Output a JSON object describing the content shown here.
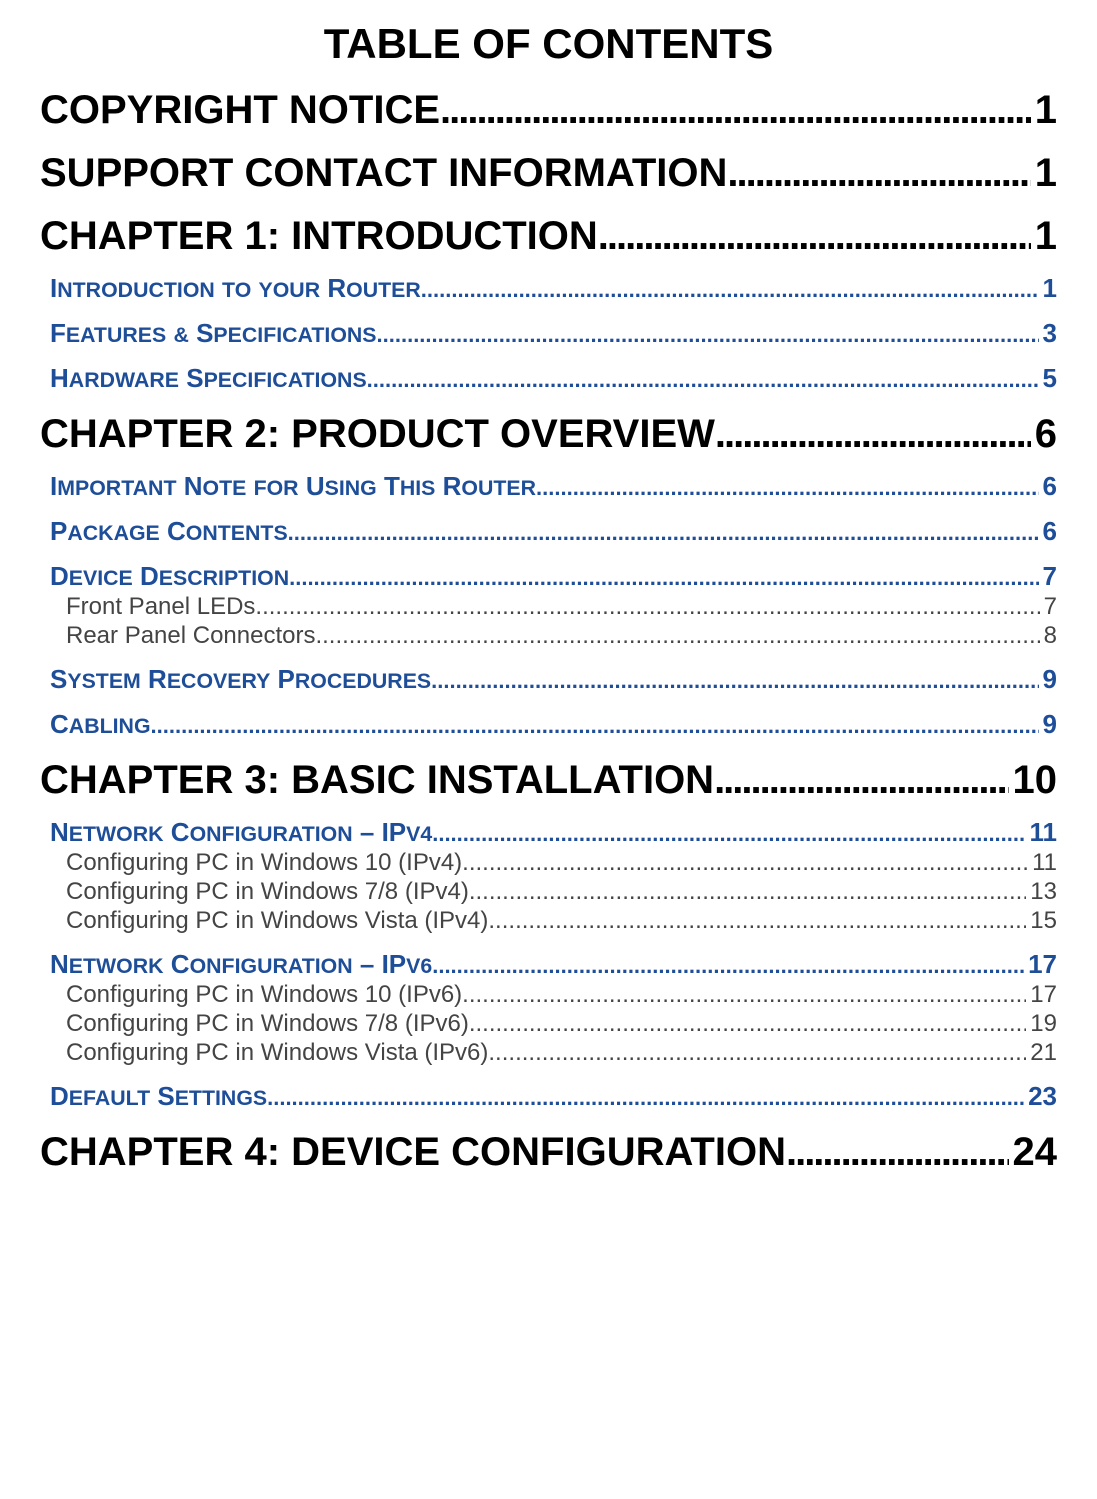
{
  "title": "TABLE OF CONTENTS",
  "entries": [
    {
      "level": 1,
      "text": "COPYRIGHT NOTICE",
      "page": "1"
    },
    {
      "level": 1,
      "text": "SUPPORT CONTACT INFORMATION",
      "page": "1"
    },
    {
      "level": 1,
      "text": "CHAPTER 1: INTRODUCTION",
      "page": "1"
    },
    {
      "level": 2,
      "text": "Introduction to your Router",
      "page": "1"
    },
    {
      "level": 2,
      "text": "Features & Specifications",
      "page": "3"
    },
    {
      "level": 2,
      "text": "Hardware Specifications",
      "page": "5"
    },
    {
      "level": 1,
      "text": "CHAPTER 2: PRODUCT OVERVIEW",
      "page": "6"
    },
    {
      "level": 2,
      "text": "Important Note for Using This Router",
      "page": "6"
    },
    {
      "level": 2,
      "text": "Package Contents",
      "page": "6"
    },
    {
      "level": 2,
      "text": "Device Description",
      "page": "7"
    },
    {
      "level": 3,
      "text": "Front Panel LEDs",
      "page": "7"
    },
    {
      "level": 3,
      "text": "Rear Panel Connectors",
      "page": "8"
    },
    {
      "level": 2,
      "text": "System Recovery Procedures",
      "page": "9"
    },
    {
      "level": 2,
      "text": "Cabling",
      "page": "9"
    },
    {
      "level": 1,
      "text": "CHAPTER 3: BASIC INSTALLATION",
      "page": "10"
    },
    {
      "level": 2,
      "text": "Network Configuration – IPv4",
      "page": " 11"
    },
    {
      "level": 3,
      "text": "Configuring PC in Windows 10 (IPv4)",
      "page": "11"
    },
    {
      "level": 3,
      "text": "Configuring PC in Windows 7/8 (IPv4)",
      "page": "13"
    },
    {
      "level": 3,
      "text": "Configuring PC in Windows Vista (IPv4)",
      "page": "15"
    },
    {
      "level": 2,
      "text": "Network Configuration – IPv6",
      "page": " 17"
    },
    {
      "level": 3,
      "text": "Configuring PC in Windows 10 (IPv6)",
      "page": "17"
    },
    {
      "level": 3,
      "text": "Configuring PC in Windows 7/8 (IPv6)",
      "page": "19"
    },
    {
      "level": 3,
      "text": "Configuring PC in Windows Vista (IPv6)",
      "page": "21"
    },
    {
      "level": 2,
      "text": "Default Settings",
      "page": "23"
    },
    {
      "level": 1,
      "text": "CHAPTER 4: DEVICE CONFIGURATION",
      "page": "24"
    }
  ]
}
